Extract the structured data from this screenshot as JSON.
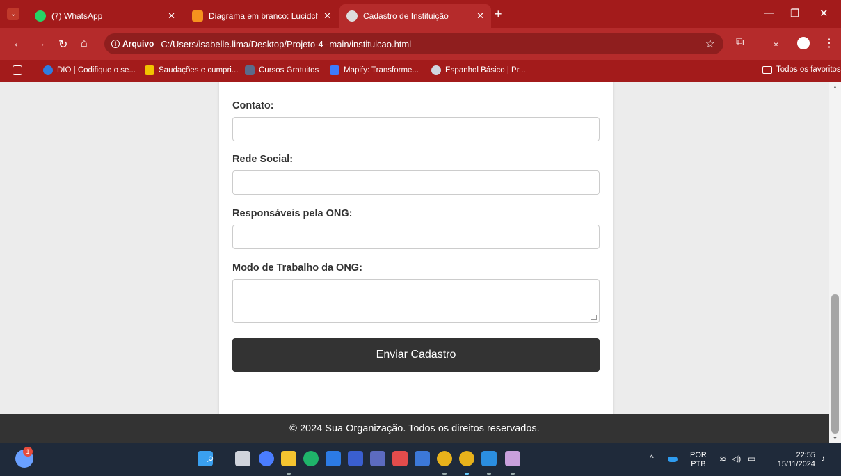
{
  "browser": {
    "tabs": [
      {
        "title": "(7) WhatsApp",
        "favicon": "whatsapp-icon",
        "color": "#25d366",
        "active": false
      },
      {
        "title": "Diagrama em branco: Lucidcha",
        "favicon": "lucidchart-icon",
        "color": "#f6921e",
        "active": false
      },
      {
        "title": "Cadastro de Instituição",
        "favicon": "globe-icon",
        "color": "#dddddd",
        "active": true
      }
    ],
    "address": {
      "chip_label": "Arquivo",
      "url": "C:/Users/isabelle.lima/Desktop/Projeto-4--main/instituicao.html"
    },
    "bookmarks": [
      {
        "label": "DIO | Codifique o se...",
        "color": "#2f7de1"
      },
      {
        "label": "Saudações e cumpri...",
        "color": "#f2c300"
      },
      {
        "label": "Cursos Gratuitos",
        "color": "#5b6b8a"
      },
      {
        "label": "Mapify: Transforme...",
        "color": "#3d7bfd"
      },
      {
        "label": "Espanhol Básico | Pr...",
        "color": "#d0d6e0"
      }
    ],
    "all_bookmarks_label": "Todos os favoritos"
  },
  "form": {
    "fields": [
      {
        "label": "Contato:",
        "type": "input",
        "value": ""
      },
      {
        "label": "Rede Social:",
        "type": "input",
        "value": ""
      },
      {
        "label": "Responsáveis pela ONG:",
        "type": "input",
        "value": ""
      },
      {
        "label": "Modo de Trabalho da ONG:",
        "type": "textarea",
        "value": ""
      }
    ],
    "submit_label": "Enviar Cadastro"
  },
  "footer": {
    "text": "© 2024 Sua Organização. Todos os direitos reservados."
  },
  "taskbar": {
    "notification_count": "1",
    "lang_top": "POR",
    "lang_bottom": "PTB",
    "time": "22:55",
    "date": "15/11/2024"
  },
  "colors": {
    "chrome_red": "#a31b1b",
    "button_dark": "#333333",
    "footer_dark": "#333333"
  }
}
